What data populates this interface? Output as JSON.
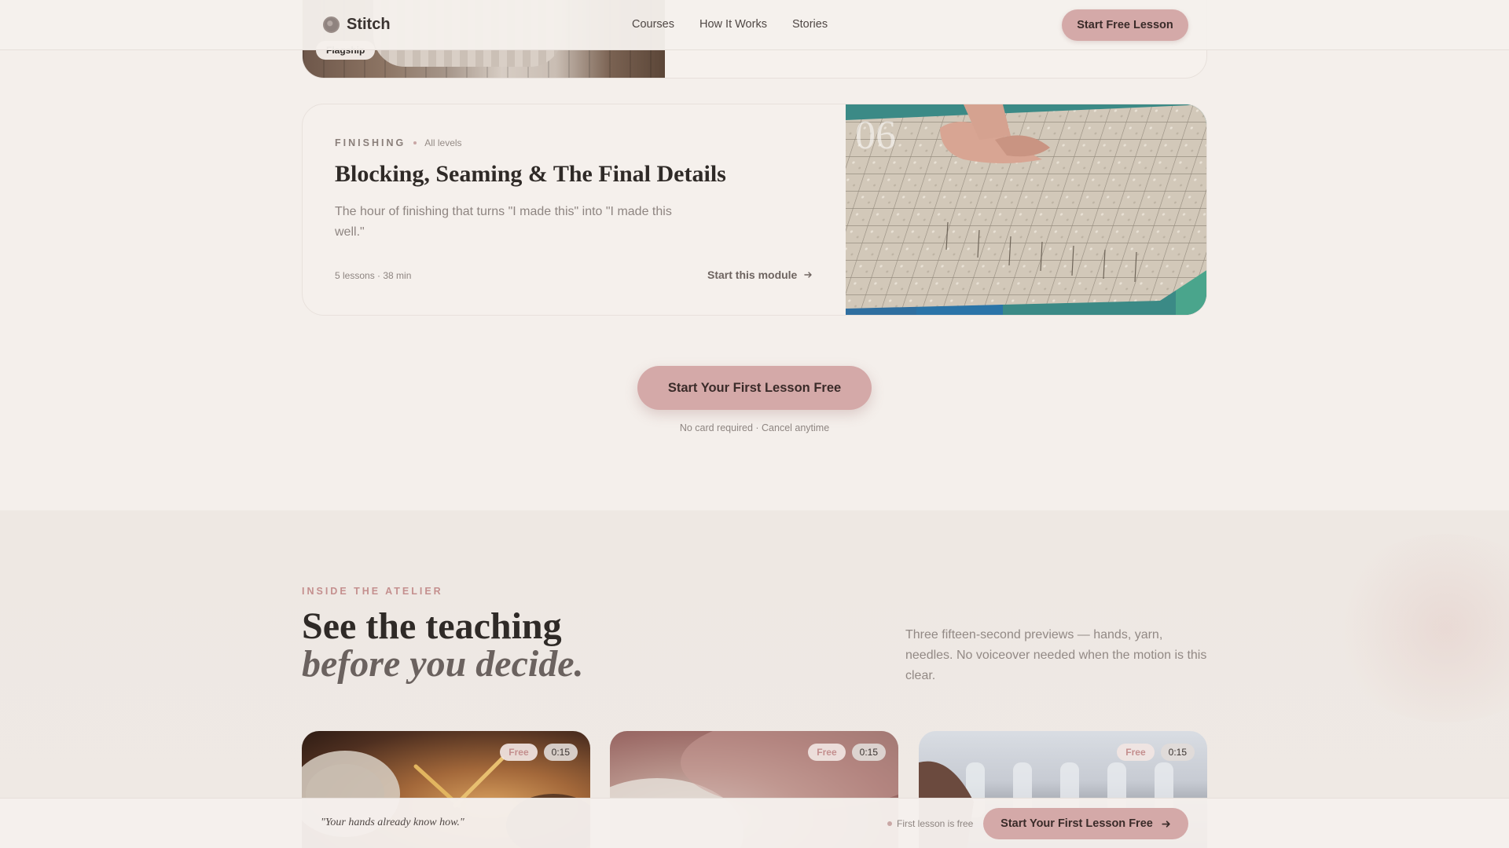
{
  "header": {
    "brand": "Stitch",
    "nav": [
      "Courses",
      "How It Works",
      "Stories"
    ],
    "cta": "Start Free Lesson"
  },
  "previous_card": {
    "badge": "Flagship"
  },
  "module": {
    "category": "FINISHING",
    "level": "All levels",
    "title": "Blocking, Seaming & The Final Details",
    "description": "The hour of finishing that turns \"I made this\" into \"I made this well.\"",
    "stats": "5 lessons · 38 min",
    "start_label": "Start this module",
    "number": "06"
  },
  "main_cta": {
    "label": "Start Your First Lesson Free",
    "note": "No card required · Cancel anytime"
  },
  "atelier": {
    "eyebrow": "INSIDE THE ATELIER",
    "headline_line1": "See the teaching",
    "headline_line2": "before you decide.",
    "description": "Three fifteen-second previews — hands, yarn, needles. No voiceover needed when the motion is this clear.",
    "previews": [
      {
        "free": "Free",
        "duration": "0:15"
      },
      {
        "free": "Free",
        "duration": "0:15"
      },
      {
        "free": "Free",
        "duration": "0:15"
      }
    ]
  },
  "bottom_bar": {
    "quote": "\"Your hands already know how.\"",
    "note": "First lesson is free",
    "cta": "Start Your First Lesson Free"
  },
  "colors": {
    "background": "#f4efeb",
    "accent": "#d4a9a8",
    "eyebrow": "#c48f8e"
  }
}
